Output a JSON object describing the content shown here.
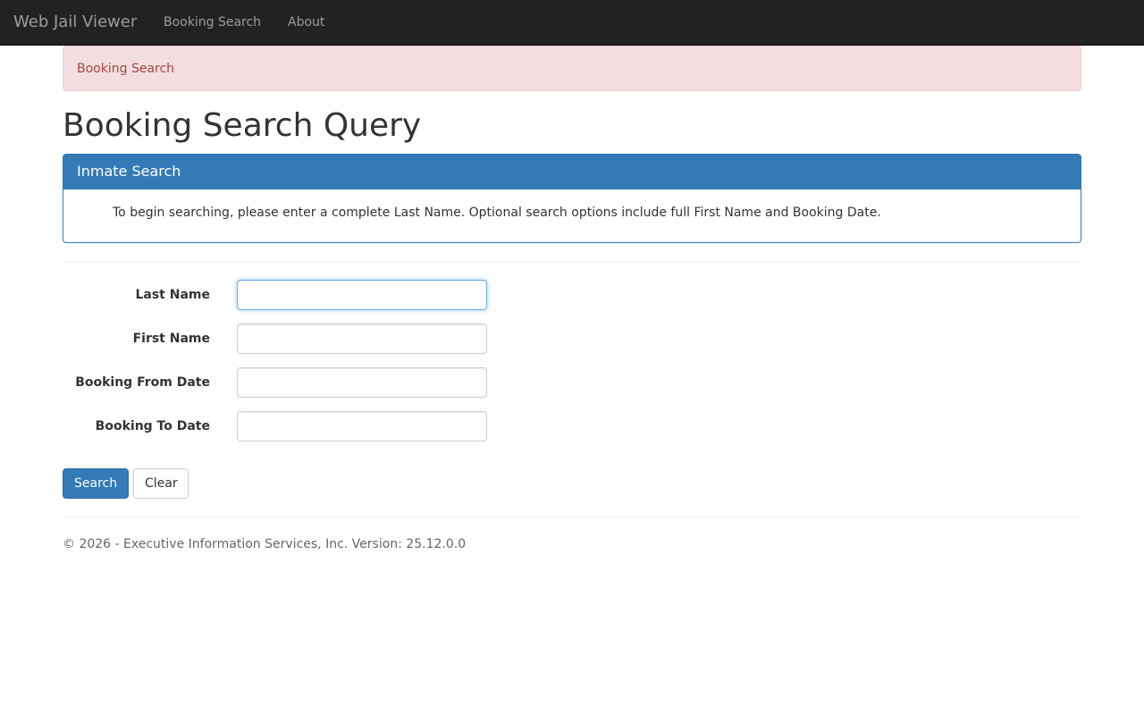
{
  "navbar": {
    "brand": "Web Jail Viewer",
    "links": [
      {
        "label": "Booking Search"
      },
      {
        "label": "About"
      }
    ]
  },
  "alert": {
    "text": "Booking Search"
  },
  "page": {
    "title": "Booking Search Query"
  },
  "panel": {
    "heading": "Inmate Search",
    "body": "To begin searching, please enter a complete Last Name. Optional search options include full First Name and Booking Date."
  },
  "form": {
    "fields": [
      {
        "label": "Last Name",
        "value": ""
      },
      {
        "label": "First Name",
        "value": ""
      },
      {
        "label": "Booking From Date",
        "value": ""
      },
      {
        "label": "Booking To Date",
        "value": ""
      }
    ],
    "search_label": "Search",
    "clear_label": "Clear"
  },
  "footer": {
    "text": "© 2026 - Executive Information Services, Inc. Version: 25.12.0.0"
  },
  "colors": {
    "navbar_bg": "#222222",
    "primary": "#337ab7",
    "alert_bg": "#f2dede",
    "alert_text": "#a94442"
  }
}
